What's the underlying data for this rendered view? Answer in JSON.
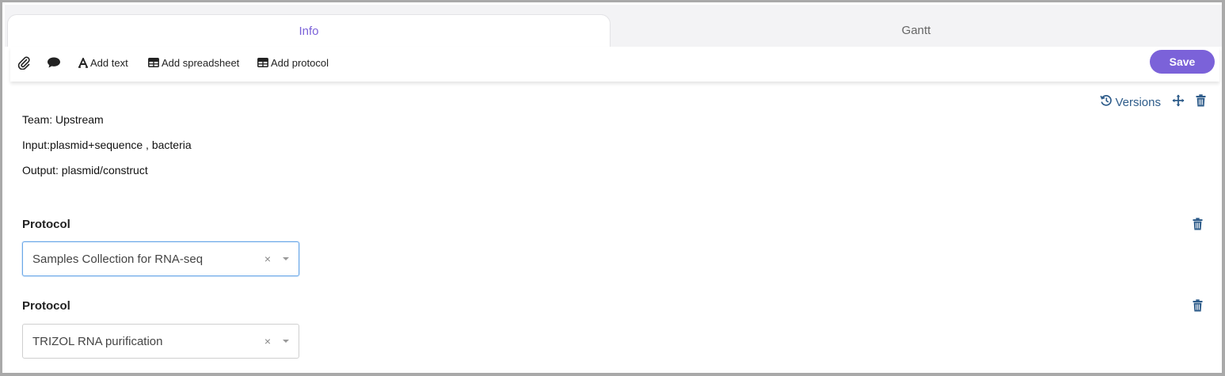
{
  "tabs": [
    {
      "label": "Info",
      "active": true
    },
    {
      "label": "Gantt",
      "active": false
    }
  ],
  "toolbar": {
    "attach_icon": "paperclip-icon",
    "comment_icon": "comment-icon",
    "add_text_label": "Add text",
    "add_spreadsheet_label": "Add spreadsheet",
    "add_protocol_label": "Add protocol",
    "save_label": "Save"
  },
  "actions": {
    "versions_label": "Versions"
  },
  "content": {
    "lines": [
      "Team: Upstream",
      "Input:plasmid+sequence , bacteria",
      "Output: plasmid/construct"
    ]
  },
  "protocols": [
    {
      "title": "Protocol",
      "selected": "Samples Collection for RNA-seq",
      "clear": "×"
    },
    {
      "title": "Protocol",
      "selected": "TRIZOL RNA purification",
      "clear": "×"
    }
  ],
  "colors": {
    "accent": "#7b62d9",
    "icon_blue": "#2e5c8a",
    "focus_border": "#6aa8e8"
  }
}
